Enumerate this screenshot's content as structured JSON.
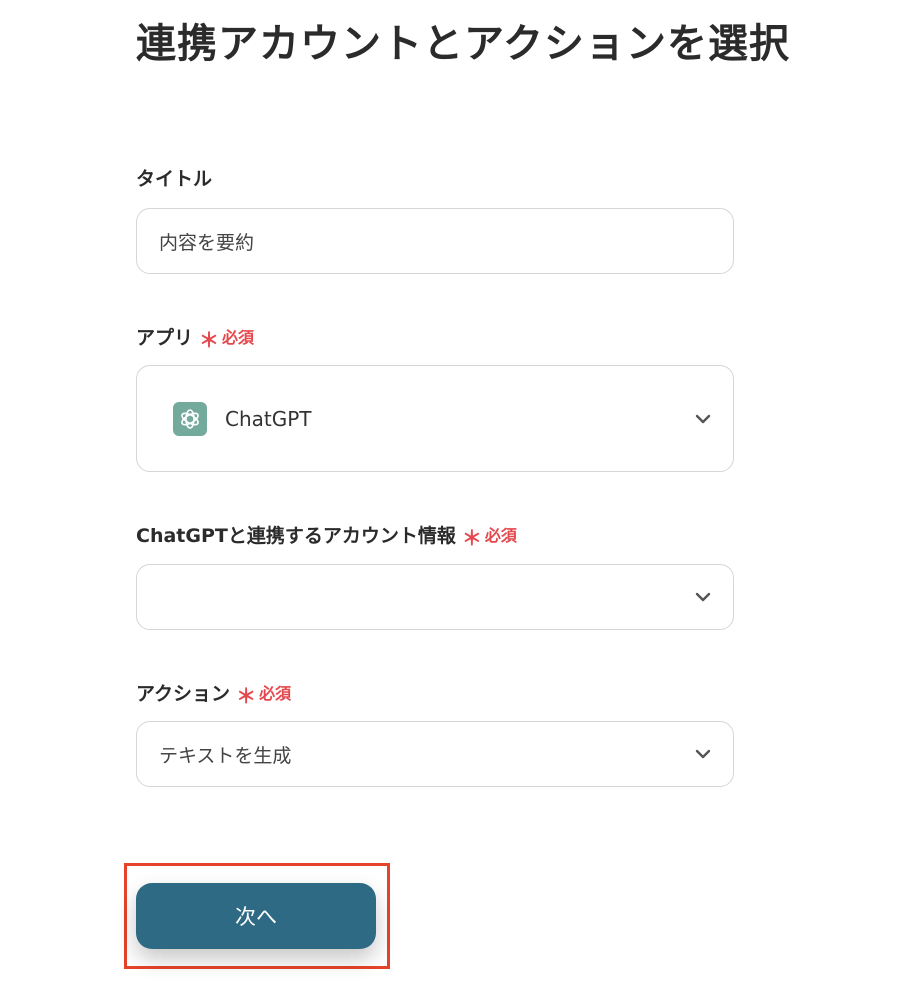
{
  "page": {
    "title": "連携アカウントとアクションを選択"
  },
  "form": {
    "title_field": {
      "label": "タイトル",
      "value": "内容を要約"
    },
    "app_field": {
      "label": "アプリ",
      "required_label": "必須",
      "app_name": "ChatGPT",
      "app_icon": "chatgpt-logo-icon"
    },
    "account_field": {
      "label": "ChatGPTと連携するアカウント情報",
      "required_label": "必須",
      "value": ""
    },
    "action_field": {
      "label": "アクション",
      "required_label": "必須",
      "value": "テキストを生成"
    },
    "required_marker": "＊"
  },
  "actions": {
    "next_label": "次へ"
  },
  "colors": {
    "primary_button": "#2e6a84",
    "required": "#e5484d",
    "highlight_frame": "#e5442a",
    "chatgpt_icon_bg": "#74aa9c"
  }
}
